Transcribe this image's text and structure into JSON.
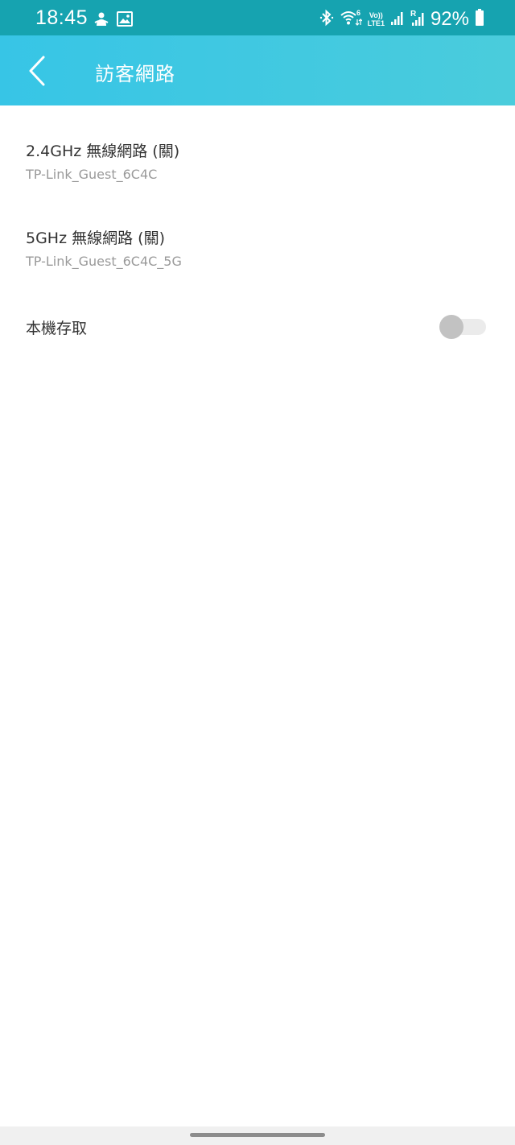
{
  "status_bar": {
    "time": "18:45",
    "left_icons": [
      "notification-icon",
      "image-icon"
    ],
    "right_icons": [
      "bluetooth-icon",
      "wifi-icon",
      "volte-icon",
      "signal-icon",
      "signal-roaming-icon",
      "battery-icon"
    ],
    "volte_label_top": "Vo))",
    "volte_label_bottom": "LTE1",
    "battery": "92%"
  },
  "header": {
    "title": "訪客網路",
    "back_icon": "chevron-left-icon",
    "background_color": "#37c5e6"
  },
  "items": [
    {
      "title": "2.4GHz 無線網路 (關)",
      "subtitle": "TP-Link_Guest_6C4C"
    },
    {
      "title": "5GHz 無線網路 (關)",
      "subtitle": "TP-Link_Guest_6C4C_5G"
    },
    {
      "title": "本機存取",
      "toggle_on": false
    }
  ]
}
